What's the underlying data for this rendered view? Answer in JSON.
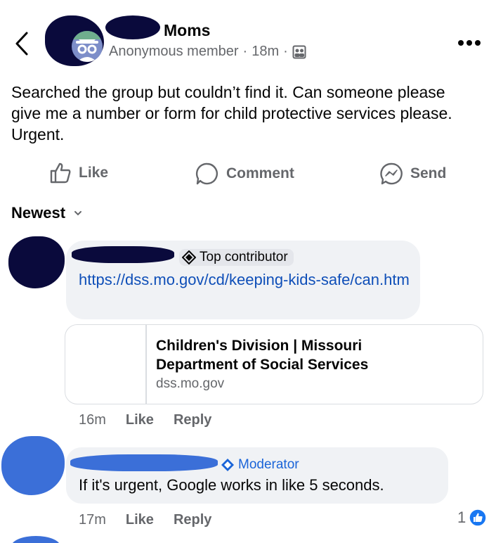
{
  "post": {
    "group_name": "Moms",
    "author": "Anonymous member",
    "sep1": "·",
    "time": "18m",
    "sep2": "·",
    "body": "Searched the group but couldn’t find it. Can someone please give me a number or form for child protective services please. Urgent."
  },
  "actions": {
    "like": "Like",
    "comment": "Comment",
    "send": "Send"
  },
  "sort": {
    "label": "Newest"
  },
  "comments": [
    {
      "badge": "Top contributor",
      "text": "https://dss.mo.gov/cd/keeping-kids-safe/can.htm",
      "link_preview": {
        "title": "Children's Division | Missouri Department of Social Services",
        "domain": "dss.mo.gov"
      },
      "time": "16m",
      "like": "Like",
      "reply": "Reply"
    },
    {
      "badge": "Moderator",
      "text": "If it's urgent, Google works in like 5 seconds.",
      "time": "17m",
      "like": "Like",
      "reply": "Reply",
      "reactions": "1"
    }
  ],
  "colors": {
    "link": "#0f4fb8",
    "reaction_blue": "#1877f2",
    "moderator_blue": "#1a64d8",
    "redaction_dark": "#0a0a3c",
    "redaction_blue": "#3b6fd8"
  }
}
